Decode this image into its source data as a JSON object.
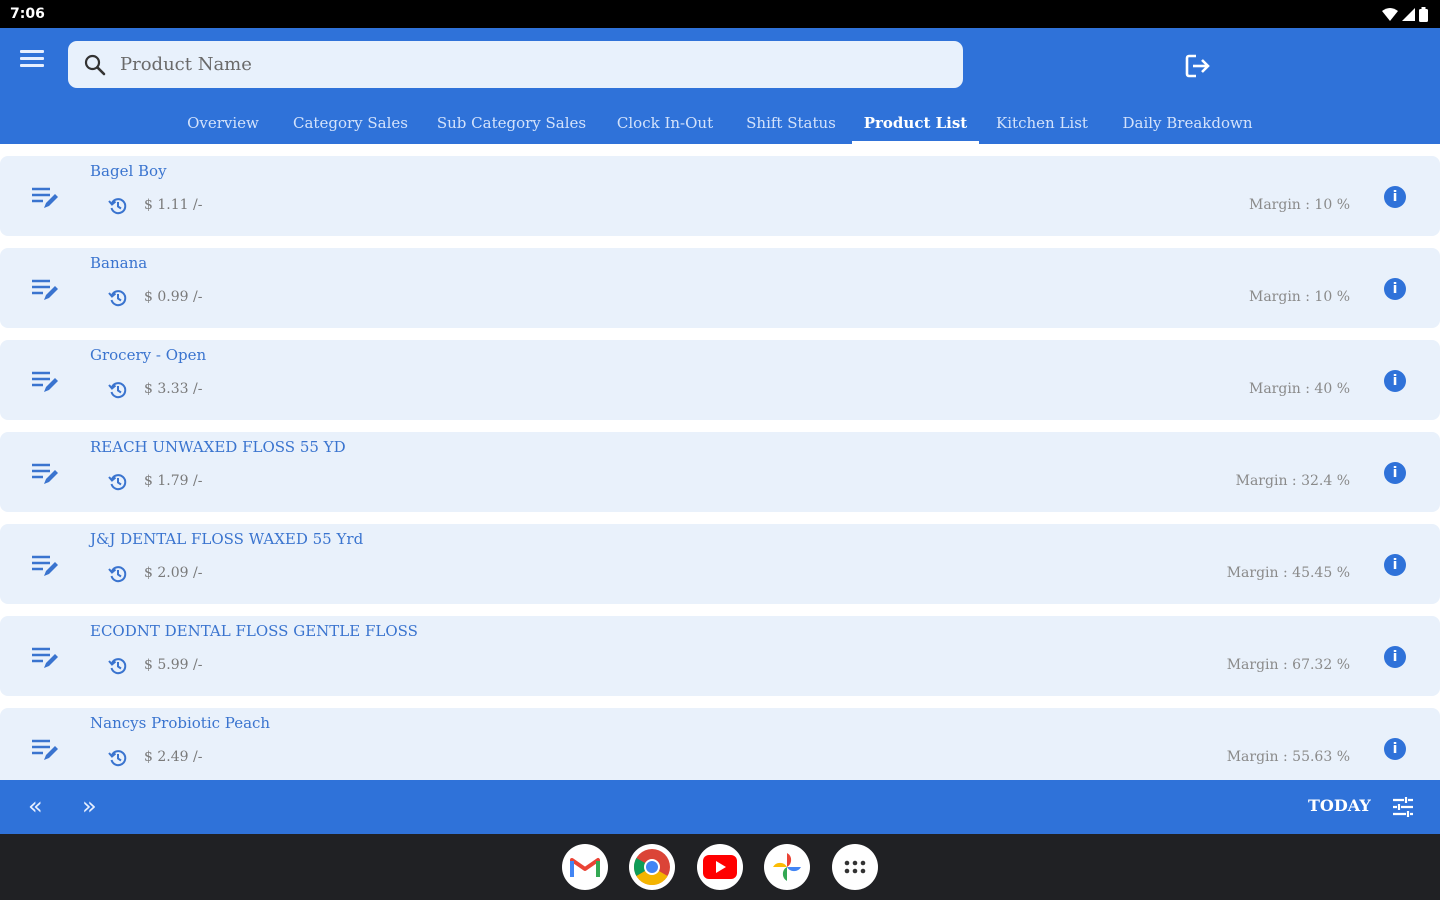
{
  "status_bar": {
    "time": "7:06"
  },
  "search": {
    "placeholder": "Product Name",
    "value": ""
  },
  "tabs": [
    {
      "label": "Overview",
      "active": false
    },
    {
      "label": "Category Sales",
      "active": false
    },
    {
      "label": "Sub Category Sales",
      "active": false
    },
    {
      "label": "Clock In-Out",
      "active": false
    },
    {
      "label": "Shift Status",
      "active": false
    },
    {
      "label": "Product List",
      "active": true
    },
    {
      "label": "Kitchen List",
      "active": false
    },
    {
      "label": "Daily Breakdown",
      "active": false
    }
  ],
  "products": [
    {
      "name": "Bagel Boy",
      "price": "$ 1.11 /-",
      "margin": "Margin : 10 %"
    },
    {
      "name": "Banana",
      "price": "$ 0.99 /-",
      "margin": "Margin : 10 %"
    },
    {
      "name": "Grocery - Open",
      "price": "$ 3.33 /-",
      "margin": "Margin : 40 %"
    },
    {
      "name": "REACH UNWAXED FLOSS 55 YD",
      "price": "$ 1.79 /-",
      "margin": "Margin : 32.4 %"
    },
    {
      "name": "J&J DENTAL FLOSS WAXED 55 Yrd",
      "price": "$ 2.09 /-",
      "margin": "Margin : 45.45 %"
    },
    {
      "name": "ECODNT DENTAL FLOSS GENTLE FLOSS",
      "price": "$ 5.99 /-",
      "margin": "Margin : 67.32 %"
    },
    {
      "name": "Nancys Probiotic Peach",
      "price": "$ 2.49 /-",
      "margin": "Margin : 55.63 %"
    }
  ],
  "bottom_bar": {
    "prev_label": "«",
    "next_label": "»",
    "today_label": "TODAY"
  },
  "info_glyph": "i",
  "colors": {
    "primary": "#2f72d9",
    "card": "#e9f1fb",
    "product_name": "#3a74cf"
  },
  "taskbar_apps": [
    "gmail-icon",
    "chrome-icon",
    "youtube-icon",
    "photos-icon",
    "app-drawer-icon"
  ]
}
